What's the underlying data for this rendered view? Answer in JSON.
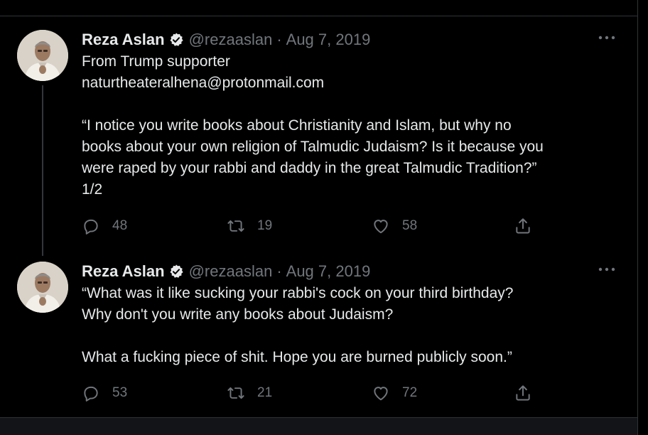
{
  "tweets": [
    {
      "author": "Reza Aslan",
      "handle": "@rezaaslan",
      "separator": "·",
      "date": "Aug 7, 2019",
      "lines": [
        "From Trump supporter",
        "naturtheateralhena@protonmail.com",
        "",
        "“I notice you write books about Christianity and Islam, but why no",
        "books about your own religion of Talmudic Judaism? Is it because you",
        "were raped by your rabbi and daddy in the great Talmudic Tradition?”",
        "1/2"
      ],
      "replies": "48",
      "retweets": "19",
      "likes": "58"
    },
    {
      "author": "Reza Aslan",
      "handle": "@rezaaslan",
      "separator": "·",
      "date": "Aug 7, 2019",
      "lines": [
        "“What was it like sucking your rabbi's cock on your third birthday?",
        "Why don't you write any books about Judaism?",
        "",
        "What a fucking piece of shit. Hope you are burned publicly soon.”"
      ],
      "replies": "53",
      "retweets": "21",
      "likes": "72"
    }
  ],
  "icons": {
    "verified": "verified-badge-icon",
    "more": "more-dots-icon",
    "reply": "reply-icon",
    "retweet": "retweet-icon",
    "like": "heart-icon",
    "share": "share-icon"
  },
  "colors": {
    "background": "#000000",
    "text": "#e7e9ea",
    "muted": "#71767b",
    "divider": "#2f3336"
  }
}
